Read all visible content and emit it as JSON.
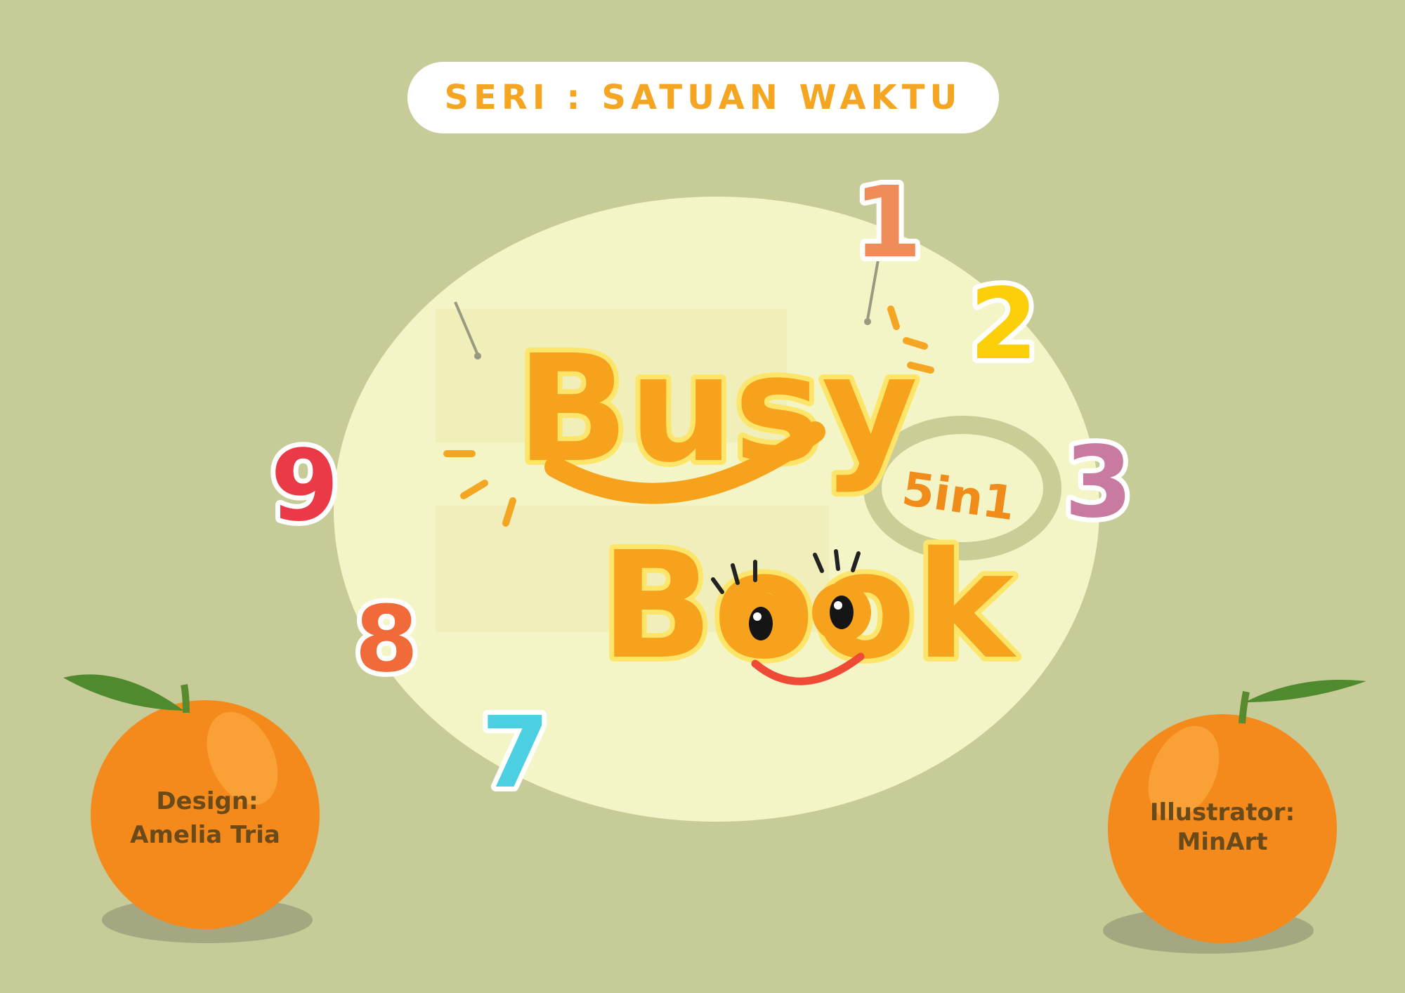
{
  "series_label": "SERI : SATUAN WAKTU",
  "title": {
    "line1": "Busy",
    "line2": "Book",
    "badge": "5in1"
  },
  "clock_numbers": [
    {
      "label": "1",
      "color": "#f08c5a"
    },
    {
      "label": "2",
      "color": "#fbcf0a"
    },
    {
      "label": "3",
      "color": "#c87aa0"
    },
    {
      "label": "7",
      "color": "#4ccfe0"
    },
    {
      "label": "8",
      "color": "#f06a3a"
    },
    {
      "label": "9",
      "color": "#ea3a48"
    }
  ],
  "credits": {
    "design_label": "Design:",
    "design_name": "Amelia Tria",
    "illustrator_label": "Illustrator:",
    "illustrator_name": "MinArt"
  },
  "colors": {
    "background": "#c6cb98",
    "accent_orange": "#f4a623",
    "blob": "#f4f5c6",
    "orange_fruit": "#f58a1c",
    "leaf": "#4f8a2e"
  }
}
